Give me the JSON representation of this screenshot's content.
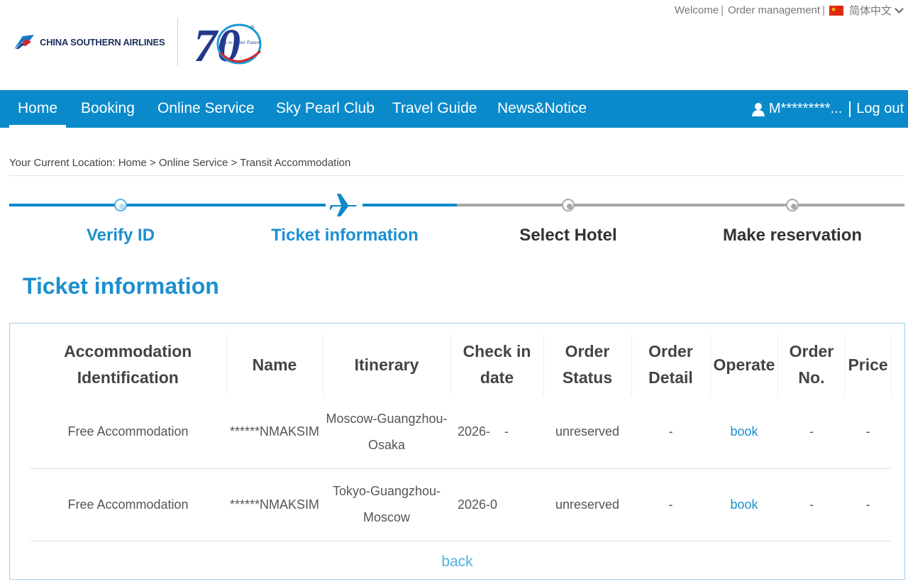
{
  "top_links": {
    "welcome": "Welcome",
    "order_management": "Order management",
    "language": "简体中文"
  },
  "logo": {
    "brand_name": "CHINA SOUTHERN AIRLINES",
    "anniversary_number": "70",
    "anniversary_suffix": "th",
    "anniversary_slogan": "Fly to Better Future"
  },
  "nav": {
    "items": [
      {
        "label": "Home",
        "active": true
      },
      {
        "label": "Booking"
      },
      {
        "label": "Online Service"
      },
      {
        "label": "Sky Pearl Club"
      },
      {
        "label": "Travel Guide"
      },
      {
        "label": "News&Notice"
      }
    ],
    "user_name": "M*********...",
    "logout": "Log out"
  },
  "breadcrumb": "Your Current Location: Home > Online Service > Transit Accommodation",
  "steps": [
    {
      "label": "Verify ID",
      "state": "done"
    },
    {
      "label": "Ticket information",
      "state": "current"
    },
    {
      "label": "Select Hotel",
      "state": "todo"
    },
    {
      "label": "Make reservation",
      "state": "todo"
    }
  ],
  "section_title": "Ticket information",
  "table": {
    "headers": [
      "Accommodation Identification",
      "Name",
      "Itinerary",
      "Check in date",
      "Order Status",
      "Order Detail",
      "Operate",
      "Order No.",
      "Price"
    ],
    "rows": [
      {
        "accommodation": "Free Accommodation",
        "name": "******NMAKSIM",
        "itinerary": "Moscow-Guangzhou-Osaka",
        "check_in": "2026-",
        "check_in_tail": "-",
        "status": "unreserved",
        "detail": "-",
        "operate": "book",
        "order_no": "-",
        "price": "-"
      },
      {
        "accommodation": "Free Accommodation",
        "name": "******NMAKSIM",
        "itinerary": "Tokyo-Guangzhou-Moscow",
        "check_in": "2026-0",
        "status": "unreserved",
        "detail": "-",
        "operate": "book",
        "order_no": "-",
        "price": "-"
      }
    ]
  },
  "back": "back",
  "colors": {
    "primary_blue": "#0a8acb",
    "accent_blue": "#1b8fcf",
    "link_blue": "#4cb0e2",
    "inactive_gray": "#a8a8a8"
  },
  "icons": {
    "user": "user-icon",
    "flag": "china-flag-icon",
    "dropdown": "chevron-down-icon",
    "plane": "airplane-icon",
    "logo": "kapok-logo-icon"
  }
}
